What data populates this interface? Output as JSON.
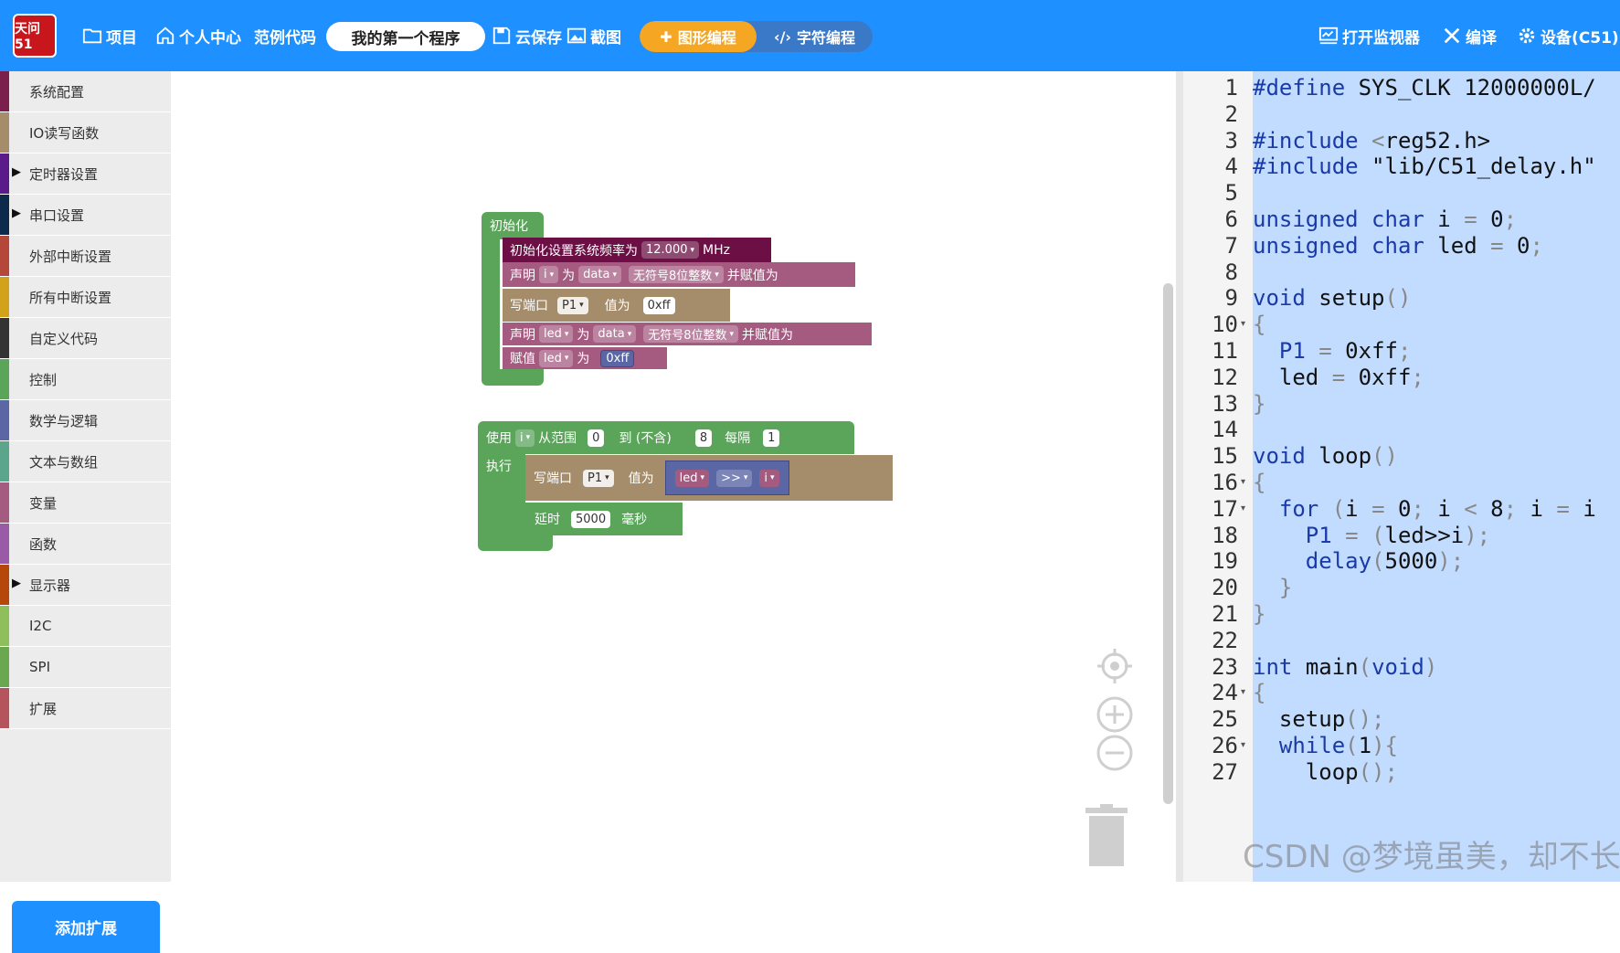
{
  "topbar": {
    "logo_text": "天问51",
    "project": "项目",
    "user_center": "个人中心",
    "examples": "范例代码",
    "program_name": "我的第一个程序",
    "cloud_save": "云保存",
    "screenshot": "截图",
    "graphic_mode": "图形编程",
    "text_mode": "字符编程",
    "open_monitor": "打开监视器",
    "compile": "编译",
    "device": "设备(C51)"
  },
  "sidebar": {
    "items": [
      {
        "label": "系统配置",
        "color": "#7b1f4c",
        "arrow": ""
      },
      {
        "label": "IO读写函数",
        "color": "#a58c6a",
        "arrow": ""
      },
      {
        "label": "定时器设置",
        "color": "#5b1a8a",
        "arrow": "▶"
      },
      {
        "label": "串口设置",
        "color": "#0e2a4a",
        "arrow": "▶"
      },
      {
        "label": "外部中断设置",
        "color": "#b5473a",
        "arrow": ""
      },
      {
        "label": "所有中断设置",
        "color": "#d1a21a",
        "arrow": ""
      },
      {
        "label": "自定义代码",
        "color": "#333333",
        "arrow": ""
      },
      {
        "label": "控制",
        "color": "#5ba55b",
        "arrow": ""
      },
      {
        "label": "数学与逻辑",
        "color": "#5b67a5",
        "arrow": ""
      },
      {
        "label": "文本与数组",
        "color": "#5ba58c",
        "arrow": ""
      },
      {
        "label": "变量",
        "color": "#a55b80",
        "arrow": ""
      },
      {
        "label": "函数",
        "color": "#995ba5",
        "arrow": ""
      },
      {
        "label": "显示器",
        "color": "#b5470a",
        "arrow": "▶"
      },
      {
        "label": "I2C",
        "color": "#8fbf5b",
        "arrow": ""
      },
      {
        "label": "SPI",
        "color": "#6aa84f",
        "arrow": ""
      },
      {
        "label": "扩展",
        "color": "#b5545b",
        "arrow": ""
      }
    ],
    "add_extension": "添加扩展"
  },
  "blocks": {
    "init_label": "初始化",
    "sysclk_text": "初始化设置系统频率为",
    "sysclk_value": "12.000",
    "sysclk_unit": "MHz",
    "declare": "声明",
    "var_i": "i",
    "as": "为",
    "data_kw": "data",
    "uint8": "无符号8位整数",
    "and_assign": "并赋值为",
    "write_port": "写端口",
    "port_p1": "P1",
    "value_is": "值为",
    "hex_ff": "0xff",
    "var_led": "led",
    "assign": "赋值",
    "use": "使用",
    "from_range": "从范围",
    "range_start": "0",
    "to_exclusive": "到 (不含)",
    "range_end": "8",
    "every": "每隔",
    "step": "1",
    "execute": "执行",
    "shift_op": ">>",
    "delay": "延时",
    "delay_value": "5000",
    "ms": "毫秒"
  },
  "code": {
    "lines": [
      "#define SYS_CLK 12000000L/",
      "",
      "#include <reg52.h>",
      "#include \"lib/C51_delay.h\"",
      "",
      "unsigned char i = 0;",
      "unsigned char led = 0;",
      "",
      "void setup()",
      "{",
      "  P1 = 0xff;",
      "  led = 0xff;",
      "}",
      "",
      "void loop()",
      "{",
      "  for (i = 0; i < 8; i = i",
      "    P1 = (led>>i);",
      "    delay(5000);",
      "  }",
      "}",
      "",
      "int main(void)",
      "{",
      "  setup();",
      "  while(1){",
      "    loop();"
    ],
    "line_numbers": [
      "1",
      "2",
      "3",
      "4",
      "5",
      "6",
      "7",
      "8",
      "9",
      "10",
      "11",
      "12",
      "13",
      "14",
      "15",
      "16",
      "17",
      "18",
      "19",
      "20",
      "21",
      "22",
      "23",
      "24",
      "25",
      "26",
      "27"
    ]
  },
  "watermark": "CSDN @梦境虽美，却不长"
}
